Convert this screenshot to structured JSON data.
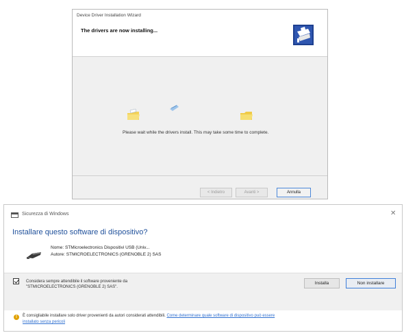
{
  "wizard": {
    "title": "Device Driver Installation Wizard",
    "heading": "The drivers are now installing...",
    "status": "Please wait while the drivers install. This may take some time to complete.",
    "buttons": {
      "back": "< Indietro",
      "next": "Avanti >",
      "cancel": "Annulla"
    },
    "icons": [
      "wizard-logo-icon",
      "folder-icon",
      "paper-flying-icon",
      "folder-icon"
    ]
  },
  "security": {
    "title": "Sicurezza di Windows",
    "close": "✕",
    "question": "Installare questo software di dispositivo?",
    "device": {
      "name": "Nome: STMicroelectronics Dispositivi USB (Univ...",
      "publisher": "Autore: STMICROELECTRONICS (GRENOBLE 2) SAS",
      "icon": "usb-device-icon"
    },
    "trust": {
      "checked": true,
      "label": "Considera sempre attendibile il software proveniente da \"STMICROELECTRONICS (GRENOBLE 2) SAS\"."
    },
    "buttons": {
      "install": "Installa",
      "dont_install": "Non installare"
    },
    "warning": {
      "icon": "warning-icon",
      "text": "È consigliabile installare solo driver provenienti da autori considerati attendibili.",
      "link_part1": "Come determinare quale software di dispositivo può essere",
      "link_part2": "installato senza pericoli"
    }
  },
  "colors": {
    "accent": "#1e4f9a",
    "link": "#2e6fd0",
    "focus_border": "#3c7dd9",
    "band": "#f0f0f0"
  }
}
